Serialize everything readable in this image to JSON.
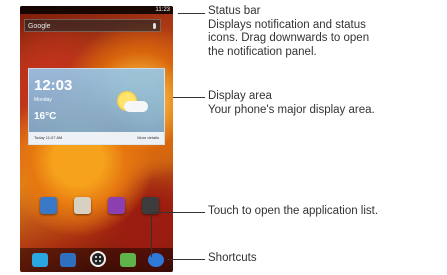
{
  "phone": {
    "status_time": "11:23",
    "search_label": "Google",
    "weather": {
      "time": "12:03",
      "date": "Monday",
      "temperature": "16°C",
      "footer_left": "Today 11:07 AM",
      "footer_right": "More details"
    },
    "apps": [
      {
        "name": "play-store",
        "color": "#3a78c8"
      },
      {
        "name": "mail",
        "color": "#d8d0c0"
      },
      {
        "name": "gallery",
        "color": "#8b3fb0"
      },
      {
        "name": "camera",
        "color": "#3c3c3c"
      }
    ],
    "dock": [
      {
        "name": "phone",
        "color": "#2aa6e0"
      },
      {
        "name": "contacts",
        "color": "#2f6fbf"
      },
      {
        "name": "messaging",
        "color": "#5fb34a"
      },
      {
        "name": "browser",
        "color": "#2f7ad8"
      }
    ]
  },
  "callouts": {
    "status_bar": {
      "title": "Status bar",
      "desc_1": "Displays notification and status",
      "desc_2": "icons. Drag downwards to open",
      "desc_3": "the notification panel."
    },
    "display_area": {
      "title": "Display area",
      "desc": "Your phone's major display area."
    },
    "app_list": "Touch to open the application list.",
    "shortcuts": "Shortcuts"
  }
}
